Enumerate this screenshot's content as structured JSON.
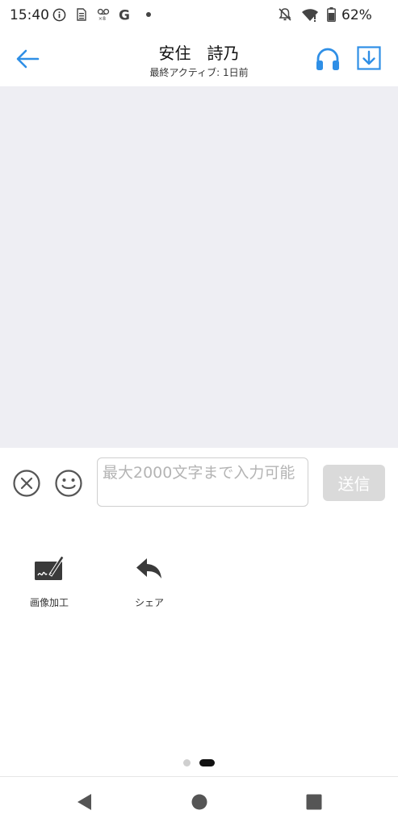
{
  "status_bar": {
    "time": "15:40",
    "battery": "62%",
    "icons": [
      "info-icon",
      "sim-icon",
      "voicemail-icon",
      "google-icon",
      "dot-icon",
      "mute-icon",
      "wifi-icon",
      "battery-icon"
    ]
  },
  "header": {
    "title": "安住　詩乃",
    "subtitle": "最終アクティブ: 1日前",
    "accent_color": "#2f8fe6"
  },
  "composer": {
    "placeholder": "最大2000文字まで入力可能",
    "send_label": "送信"
  },
  "tools": [
    {
      "label": "画像加工",
      "icon": "image-edit-icon"
    },
    {
      "label": "シェア",
      "icon": "share-icon"
    }
  ],
  "pager": {
    "total": 2,
    "current": 2
  }
}
